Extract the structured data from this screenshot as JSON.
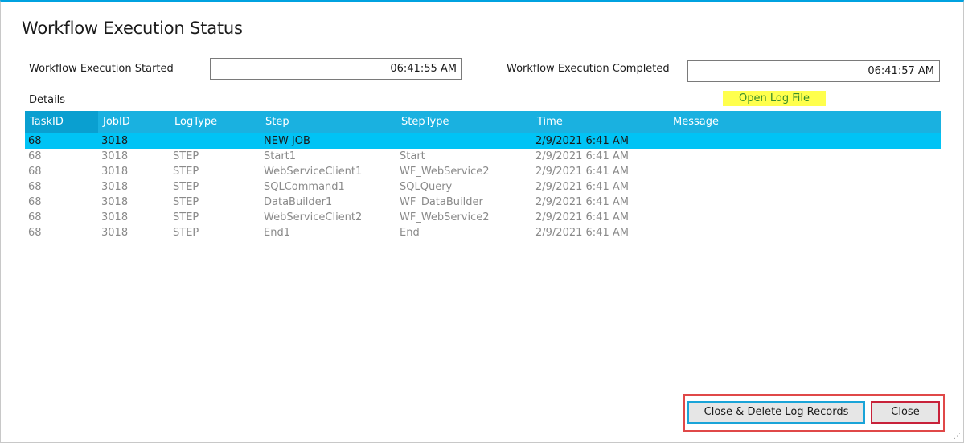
{
  "window": {
    "title": "Workflow Execution Status"
  },
  "started": {
    "label": "Workflow Execution Started",
    "value": "06:41:55 AM"
  },
  "completed": {
    "label": "Workflow Execution Completed",
    "value": "06:41:57 AM"
  },
  "details_label": "Details",
  "open_log_label": "Open Log File",
  "grid": {
    "columns": [
      "TaskID",
      "JobID",
      "LogType",
      "Step",
      "StepType",
      "Time",
      "Message"
    ],
    "rows": [
      [
        "68",
        "3018",
        "",
        "NEW JOB",
        "",
        "2/9/2021 6:41 AM",
        ""
      ],
      [
        "68",
        "3018",
        "STEP",
        "Start1",
        "Start",
        "2/9/2021 6:41 AM",
        ""
      ],
      [
        "68",
        "3018",
        "STEP",
        "WebServiceClient1",
        "WF_WebService2",
        "2/9/2021 6:41 AM",
        ""
      ],
      [
        "68",
        "3018",
        "STEP",
        "SQLCommand1",
        "SQLQuery",
        "2/9/2021 6:41 AM",
        ""
      ],
      [
        "68",
        "3018",
        "STEP",
        "DataBuilder1",
        "WF_DataBuilder",
        "2/9/2021 6:41 AM",
        ""
      ],
      [
        "68",
        "3018",
        "STEP",
        "WebServiceClient2",
        "WF_WebService2",
        "2/9/2021 6:41 AM",
        ""
      ],
      [
        "68",
        "3018",
        "STEP",
        "End1",
        "End",
        "2/9/2021 6:41 AM",
        ""
      ]
    ],
    "selected_row": 0
  },
  "buttons": {
    "delete_label": "Close & Delete Log Records",
    "close_label": "Close"
  },
  "colors": {
    "accent": "#00a2e0",
    "header_bg": "#1ab1e0",
    "selected_row_bg": "#00c3f5",
    "highlight_red": "#e04848",
    "open_log_bg": "#ffff4d",
    "open_log_text": "#3a8d2a"
  }
}
